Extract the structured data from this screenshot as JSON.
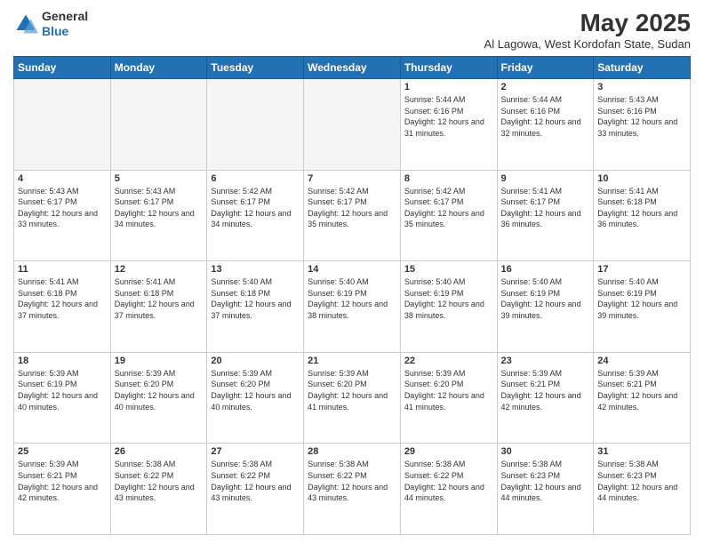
{
  "header": {
    "logo_line1": "General",
    "logo_line2": "Blue",
    "title": "May 2025",
    "subtitle": "Al Lagowa, West Kordofan State, Sudan"
  },
  "days_of_week": [
    "Sunday",
    "Monday",
    "Tuesday",
    "Wednesday",
    "Thursday",
    "Friday",
    "Saturday"
  ],
  "weeks": [
    [
      {
        "day": "",
        "empty": true
      },
      {
        "day": "",
        "empty": true
      },
      {
        "day": "",
        "empty": true
      },
      {
        "day": "",
        "empty": true
      },
      {
        "day": "1",
        "sunrise": "5:44 AM",
        "sunset": "6:16 PM",
        "daylight": "12 hours and 31 minutes."
      },
      {
        "day": "2",
        "sunrise": "5:44 AM",
        "sunset": "6:16 PM",
        "daylight": "12 hours and 32 minutes."
      },
      {
        "day": "3",
        "sunrise": "5:43 AM",
        "sunset": "6:16 PM",
        "daylight": "12 hours and 33 minutes."
      }
    ],
    [
      {
        "day": "4",
        "sunrise": "5:43 AM",
        "sunset": "6:17 PM",
        "daylight": "12 hours and 33 minutes."
      },
      {
        "day": "5",
        "sunrise": "5:43 AM",
        "sunset": "6:17 PM",
        "daylight": "12 hours and 34 minutes."
      },
      {
        "day": "6",
        "sunrise": "5:42 AM",
        "sunset": "6:17 PM",
        "daylight": "12 hours and 34 minutes."
      },
      {
        "day": "7",
        "sunrise": "5:42 AM",
        "sunset": "6:17 PM",
        "daylight": "12 hours and 35 minutes."
      },
      {
        "day": "8",
        "sunrise": "5:42 AM",
        "sunset": "6:17 PM",
        "daylight": "12 hours and 35 minutes."
      },
      {
        "day": "9",
        "sunrise": "5:41 AM",
        "sunset": "6:17 PM",
        "daylight": "12 hours and 36 minutes."
      },
      {
        "day": "10",
        "sunrise": "5:41 AM",
        "sunset": "6:18 PM",
        "daylight": "12 hours and 36 minutes."
      }
    ],
    [
      {
        "day": "11",
        "sunrise": "5:41 AM",
        "sunset": "6:18 PM",
        "daylight": "12 hours and 37 minutes."
      },
      {
        "day": "12",
        "sunrise": "5:41 AM",
        "sunset": "6:18 PM",
        "daylight": "12 hours and 37 minutes."
      },
      {
        "day": "13",
        "sunrise": "5:40 AM",
        "sunset": "6:18 PM",
        "daylight": "12 hours and 37 minutes."
      },
      {
        "day": "14",
        "sunrise": "5:40 AM",
        "sunset": "6:19 PM",
        "daylight": "12 hours and 38 minutes."
      },
      {
        "day": "15",
        "sunrise": "5:40 AM",
        "sunset": "6:19 PM",
        "daylight": "12 hours and 38 minutes."
      },
      {
        "day": "16",
        "sunrise": "5:40 AM",
        "sunset": "6:19 PM",
        "daylight": "12 hours and 39 minutes."
      },
      {
        "day": "17",
        "sunrise": "5:40 AM",
        "sunset": "6:19 PM",
        "daylight": "12 hours and 39 minutes."
      }
    ],
    [
      {
        "day": "18",
        "sunrise": "5:39 AM",
        "sunset": "6:19 PM",
        "daylight": "12 hours and 40 minutes."
      },
      {
        "day": "19",
        "sunrise": "5:39 AM",
        "sunset": "6:20 PM",
        "daylight": "12 hours and 40 minutes."
      },
      {
        "day": "20",
        "sunrise": "5:39 AM",
        "sunset": "6:20 PM",
        "daylight": "12 hours and 40 minutes."
      },
      {
        "day": "21",
        "sunrise": "5:39 AM",
        "sunset": "6:20 PM",
        "daylight": "12 hours and 41 minutes."
      },
      {
        "day": "22",
        "sunrise": "5:39 AM",
        "sunset": "6:20 PM",
        "daylight": "12 hours and 41 minutes."
      },
      {
        "day": "23",
        "sunrise": "5:39 AM",
        "sunset": "6:21 PM",
        "daylight": "12 hours and 42 minutes."
      },
      {
        "day": "24",
        "sunrise": "5:39 AM",
        "sunset": "6:21 PM",
        "daylight": "12 hours and 42 minutes."
      }
    ],
    [
      {
        "day": "25",
        "sunrise": "5:39 AM",
        "sunset": "6:21 PM",
        "daylight": "12 hours and 42 minutes."
      },
      {
        "day": "26",
        "sunrise": "5:38 AM",
        "sunset": "6:22 PM",
        "daylight": "12 hours and 43 minutes."
      },
      {
        "day": "27",
        "sunrise": "5:38 AM",
        "sunset": "6:22 PM",
        "daylight": "12 hours and 43 minutes."
      },
      {
        "day": "28",
        "sunrise": "5:38 AM",
        "sunset": "6:22 PM",
        "daylight": "12 hours and 43 minutes."
      },
      {
        "day": "29",
        "sunrise": "5:38 AM",
        "sunset": "6:22 PM",
        "daylight": "12 hours and 44 minutes."
      },
      {
        "day": "30",
        "sunrise": "5:38 AM",
        "sunset": "6:23 PM",
        "daylight": "12 hours and 44 minutes."
      },
      {
        "day": "31",
        "sunrise": "5:38 AM",
        "sunset": "6:23 PM",
        "daylight": "12 hours and 44 minutes."
      }
    ]
  ]
}
